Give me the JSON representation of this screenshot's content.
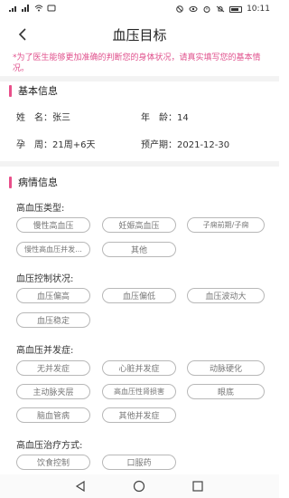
{
  "status_bar": {
    "left_icons": [
      "sim-signal-icon",
      "signal-4g-icon",
      "wifi-icon",
      "notification-icon"
    ],
    "right_icons": [
      "nfc-icon",
      "eye-icon",
      "alarm-icon",
      "silent-icon",
      "battery-icon"
    ],
    "time": "10:11"
  },
  "header": {
    "back_icon": "chevron-left-icon",
    "title": "血压目标"
  },
  "notice": "*为了医生能够更加准确的判断您的身体状况，请真实填写您的基本情况。",
  "basic": {
    "title": "基本信息",
    "name_label": "姓　名：",
    "name_value": "张三",
    "age_label": "年　龄：",
    "age_value": "14",
    "preg_label": "孕　周：",
    "preg_value": "21周+6天",
    "due_label": "预产期：",
    "due_value": "2021-12-30"
  },
  "condition": {
    "title": "病情信息",
    "groups": [
      {
        "label": "高血压类型:",
        "options": [
          "慢性高血压",
          "妊娠高血压",
          "子痫前期/子痫",
          "慢性高血压并发...",
          "其他"
        ]
      },
      {
        "label": "血压控制状况:",
        "options": [
          "血压偏高",
          "血压偏低",
          "血压波动大",
          "血压稳定"
        ]
      },
      {
        "label": "高血压并发症:",
        "options": [
          "无并发症",
          "心脏并发症",
          "动脉硬化",
          "主动脉夹层",
          "高血压性肾损害",
          "眼底",
          "脑血管病",
          "其他并发症"
        ]
      },
      {
        "label": "高血压治疗方式:",
        "options": [
          "饮食控制",
          "口服药"
        ]
      }
    ]
  },
  "system_nav": {
    "back_icon": "triangle-back-icon",
    "home_icon": "circle-home-icon",
    "recent_icon": "square-recent-icon"
  },
  "colors": {
    "accent": "#e94f8a",
    "notice": "#e0508c",
    "separator": "#f3f3f3",
    "tag_border": "#b8b8b8"
  }
}
